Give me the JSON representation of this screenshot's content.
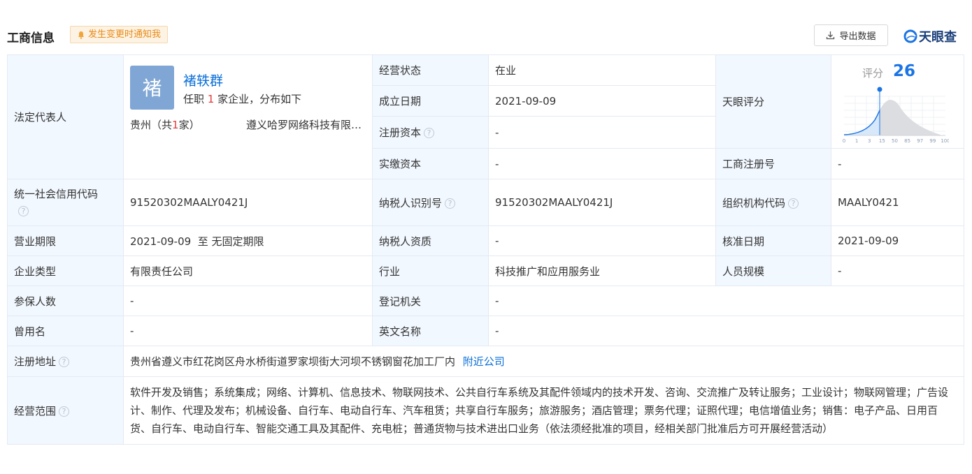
{
  "header": {
    "title": "工商信息",
    "notify_label": "发生变更时通知我",
    "export_label": "导出数据",
    "brand_name": "天眼查"
  },
  "legal_rep": {
    "label": "法定代表人",
    "avatar_char": "褚",
    "name": "褚轶群",
    "positions_prefix": "任职",
    "positions_count": "1",
    "positions_suffix": "家企业，分布如下",
    "region": "贵州（共",
    "region_count": "1",
    "region_suffix": "家）",
    "company": "遵义哈罗网络科技有限公司"
  },
  "fields": {
    "status": {
      "label": "经营状态",
      "value": "在业"
    },
    "founded": {
      "label": "成立日期",
      "value": "2021-09-09"
    },
    "reg_capital": {
      "label": "注册资本",
      "value": "-"
    },
    "paid_capital": {
      "label": "实缴资本",
      "value": "-"
    },
    "tianyan_score": {
      "label": "天眼评分"
    },
    "biz_reg_no": {
      "label": "工商注册号",
      "value": "-"
    },
    "credit_code": {
      "label": "统一社会信用代码",
      "value": "91520302MAALY0421J"
    },
    "taxpayer_id": {
      "label": "纳税人识别号",
      "value": "91520302MAALY0421J"
    },
    "org_code": {
      "label": "组织机构代码",
      "value": "MAALY0421"
    },
    "term": {
      "label": "营业期限",
      "value": "2021-09-09  至 无固定期限"
    },
    "taxpayer_qual": {
      "label": "纳税人资质",
      "value": "-"
    },
    "approval_date": {
      "label": "核准日期",
      "value": "2021-09-09"
    },
    "company_type": {
      "label": "企业类型",
      "value": "有限责任公司"
    },
    "industry": {
      "label": "行业",
      "value": "科技推广和应用服务业"
    },
    "staff_size": {
      "label": "人员规模",
      "value": "-"
    },
    "insured": {
      "label": "参保人数",
      "value": "-"
    },
    "reg_authority": {
      "label": "登记机关",
      "value": "-"
    },
    "former_name": {
      "label": "曾用名",
      "value": "-"
    },
    "english_name": {
      "label": "英文名称",
      "value": "-"
    },
    "address": {
      "label": "注册地址",
      "value": "贵州省遵义市红花岗区舟水桥街道罗家坝街大河坝不锈钢窗花加工厂内",
      "link": "附近公司"
    },
    "scope": {
      "label": "经营范围",
      "value": "软件开发及销售；系统集成；网络、计算机、信息技术、物联网技术、公共自行车系统及其配件领域内的技术开发、咨询、交流推广及转让服务；工业设计；物联网管理；广告设计、制作、代理及发布；机械设备、自行车、电动自行车、汽车租赁；共享自行车服务；旅游服务；酒店管理；票务代理；证照代理；电信增值业务；销售：电子产品、日用百货、自行车、电动自行车、智能交通工具及其配件、充电桩；普通货物与技术进出口业务（依法须经批准的项目，经相关部门批准后方可开展经营活动）"
    }
  },
  "score": {
    "label": "评分",
    "value": "26",
    "ticks": [
      "0",
      "1",
      "3",
      "15",
      "50",
      "85",
      "97",
      "99",
      "100"
    ]
  },
  "colors": {
    "accent": "#0b6fd8",
    "label_bg": "#f2f8ff",
    "border": "#e4eaf2"
  }
}
